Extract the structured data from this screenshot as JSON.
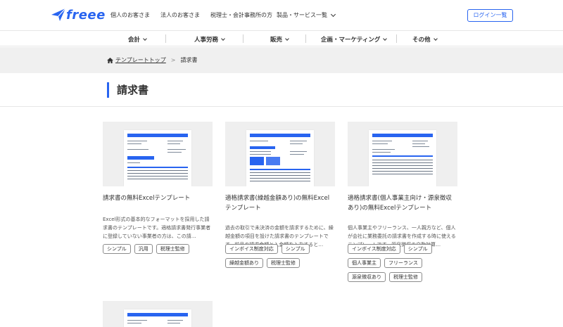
{
  "header": {
    "logo": "freee",
    "top_nav": [
      "個人のお客さま",
      "法人のお客さま",
      "税理士・会計事務所の方"
    ],
    "products_label": "製品・サービス一覧",
    "login_label": "ログイン一覧"
  },
  "subnav": [
    "会計",
    "人事労務",
    "販売",
    "企画・マーケティング",
    "その他"
  ],
  "breadcrumb": {
    "home": "テンプレートトップ",
    "current": "請求書"
  },
  "page_title": "請求書",
  "cards": [
    {
      "title": "請求書の無料Excelテンプレート",
      "description": "Excel形式の基本的なフォーマットを採用した請求書のテンプレートです。適格請求書発行事業者に登録していない事業者の方は、この請…",
      "tags": [
        "シンプル",
        "汎用",
        "税理士監修"
      ]
    },
    {
      "title": "適格請求書(繰越金額あり)の無料Excelテンプレート",
      "description": "過去の取引で未決済の金額を請求するために、繰越金額の項目を設けた請求書のテンプレートです。前月の請求金額と入金額を入力すると…",
      "tags": [
        "インボイス制度対応",
        "シンプル",
        "繰越金額あり",
        "税理士監修"
      ]
    },
    {
      "title": "適格請求書(個人事業主向け・源泉徴収あり)の無料Excelテンプレート",
      "description": "個人事業主やフリーランス、一人親方など、個人が会社に業務委託の請求書を作成する時に使えるテンプレートです。源泉徴収の自動計算…",
      "tags": [
        "インボイス制度対応",
        "シンプル",
        "個人事業主",
        "フリーランス",
        "源泉徴収あり",
        "税理士監修"
      ]
    }
  ],
  "colors": {
    "accent": "#2864f0",
    "band": "#f0f0f0"
  }
}
